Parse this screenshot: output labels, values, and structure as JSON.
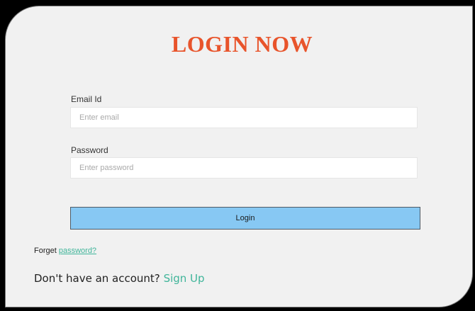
{
  "login": {
    "title": "LOGIN NOW",
    "email_label": "Email Id",
    "email_placeholder": "Enter email",
    "password_label": "Password",
    "password_placeholder": "Enter password",
    "login_button": "Login",
    "forget_prefix": "Forget",
    "forget_link": "password?",
    "no_account_text": "Don't have an account?",
    "signup_link": "Sign Up"
  },
  "colors": {
    "title": "#e8542b",
    "button": "#87c8f3",
    "link": "#40b59a",
    "card_background": "#f1f1f1"
  }
}
